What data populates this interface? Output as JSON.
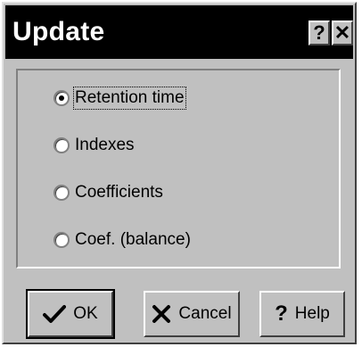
{
  "window": {
    "title": "Update",
    "help_glyph": "?",
    "close_glyph": "✕"
  },
  "options": [
    {
      "label": "Retention time",
      "selected": true
    },
    {
      "label": "Indexes",
      "selected": false
    },
    {
      "label": "Coefficients",
      "selected": false
    },
    {
      "label": "Coef. (balance)",
      "selected": false
    }
  ],
  "buttons": {
    "ok_label": "OK",
    "cancel_label": "Cancel",
    "help_label": "Help",
    "help_icon_glyph": "?"
  },
  "icons": {
    "ok": "checkmark-icon",
    "cancel": "x-icon",
    "help": "question-icon"
  }
}
